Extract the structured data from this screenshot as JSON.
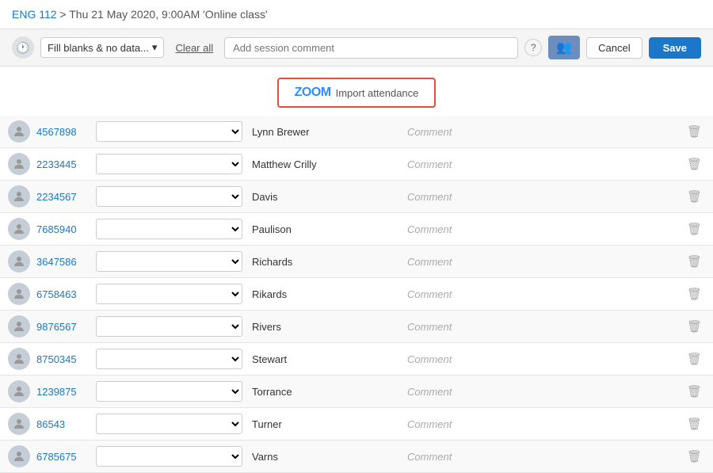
{
  "breadcrumb": {
    "course": "ENG 112",
    "session": "Thu 21 May 2020, 9:00AM 'Online class'",
    "separator": " > "
  },
  "toolbar": {
    "fill_select_label": "Fill blanks & no data...",
    "clear_all_label": "Clear all",
    "session_comment_placeholder": "Add session comment",
    "cancel_label": "Cancel",
    "save_label": "Save"
  },
  "zoom_import": {
    "logo": "ZOOM",
    "label": "Import attendance"
  },
  "students": [
    {
      "id": "4567898",
      "name": "Lynn Brewer",
      "comment": "Comment"
    },
    {
      "id": "2233445",
      "name": "Matthew Crilly",
      "comment": "Comment"
    },
    {
      "id": "2234567",
      "name": "Davis",
      "comment": "Comment"
    },
    {
      "id": "7685940",
      "name": "Paulison",
      "comment": "Comment"
    },
    {
      "id": "3647586",
      "name": "Richards",
      "comment": "Comment"
    },
    {
      "id": "6758463",
      "name": "Rikards",
      "comment": "Comment"
    },
    {
      "id": "9876567",
      "name": "Rivers",
      "comment": "Comment"
    },
    {
      "id": "8750345",
      "name": "Stewart",
      "comment": "Comment"
    },
    {
      "id": "1239875",
      "name": "Torrance",
      "comment": "Comment"
    },
    {
      "id": "86543",
      "name": "Turner",
      "comment": "Comment"
    },
    {
      "id": "6785675",
      "name": "Varns",
      "comment": "Comment"
    }
  ],
  "icons": {
    "clock": "🕐",
    "avatar": "👤",
    "add_user": "👥",
    "delete": "🗑",
    "help": "?"
  }
}
